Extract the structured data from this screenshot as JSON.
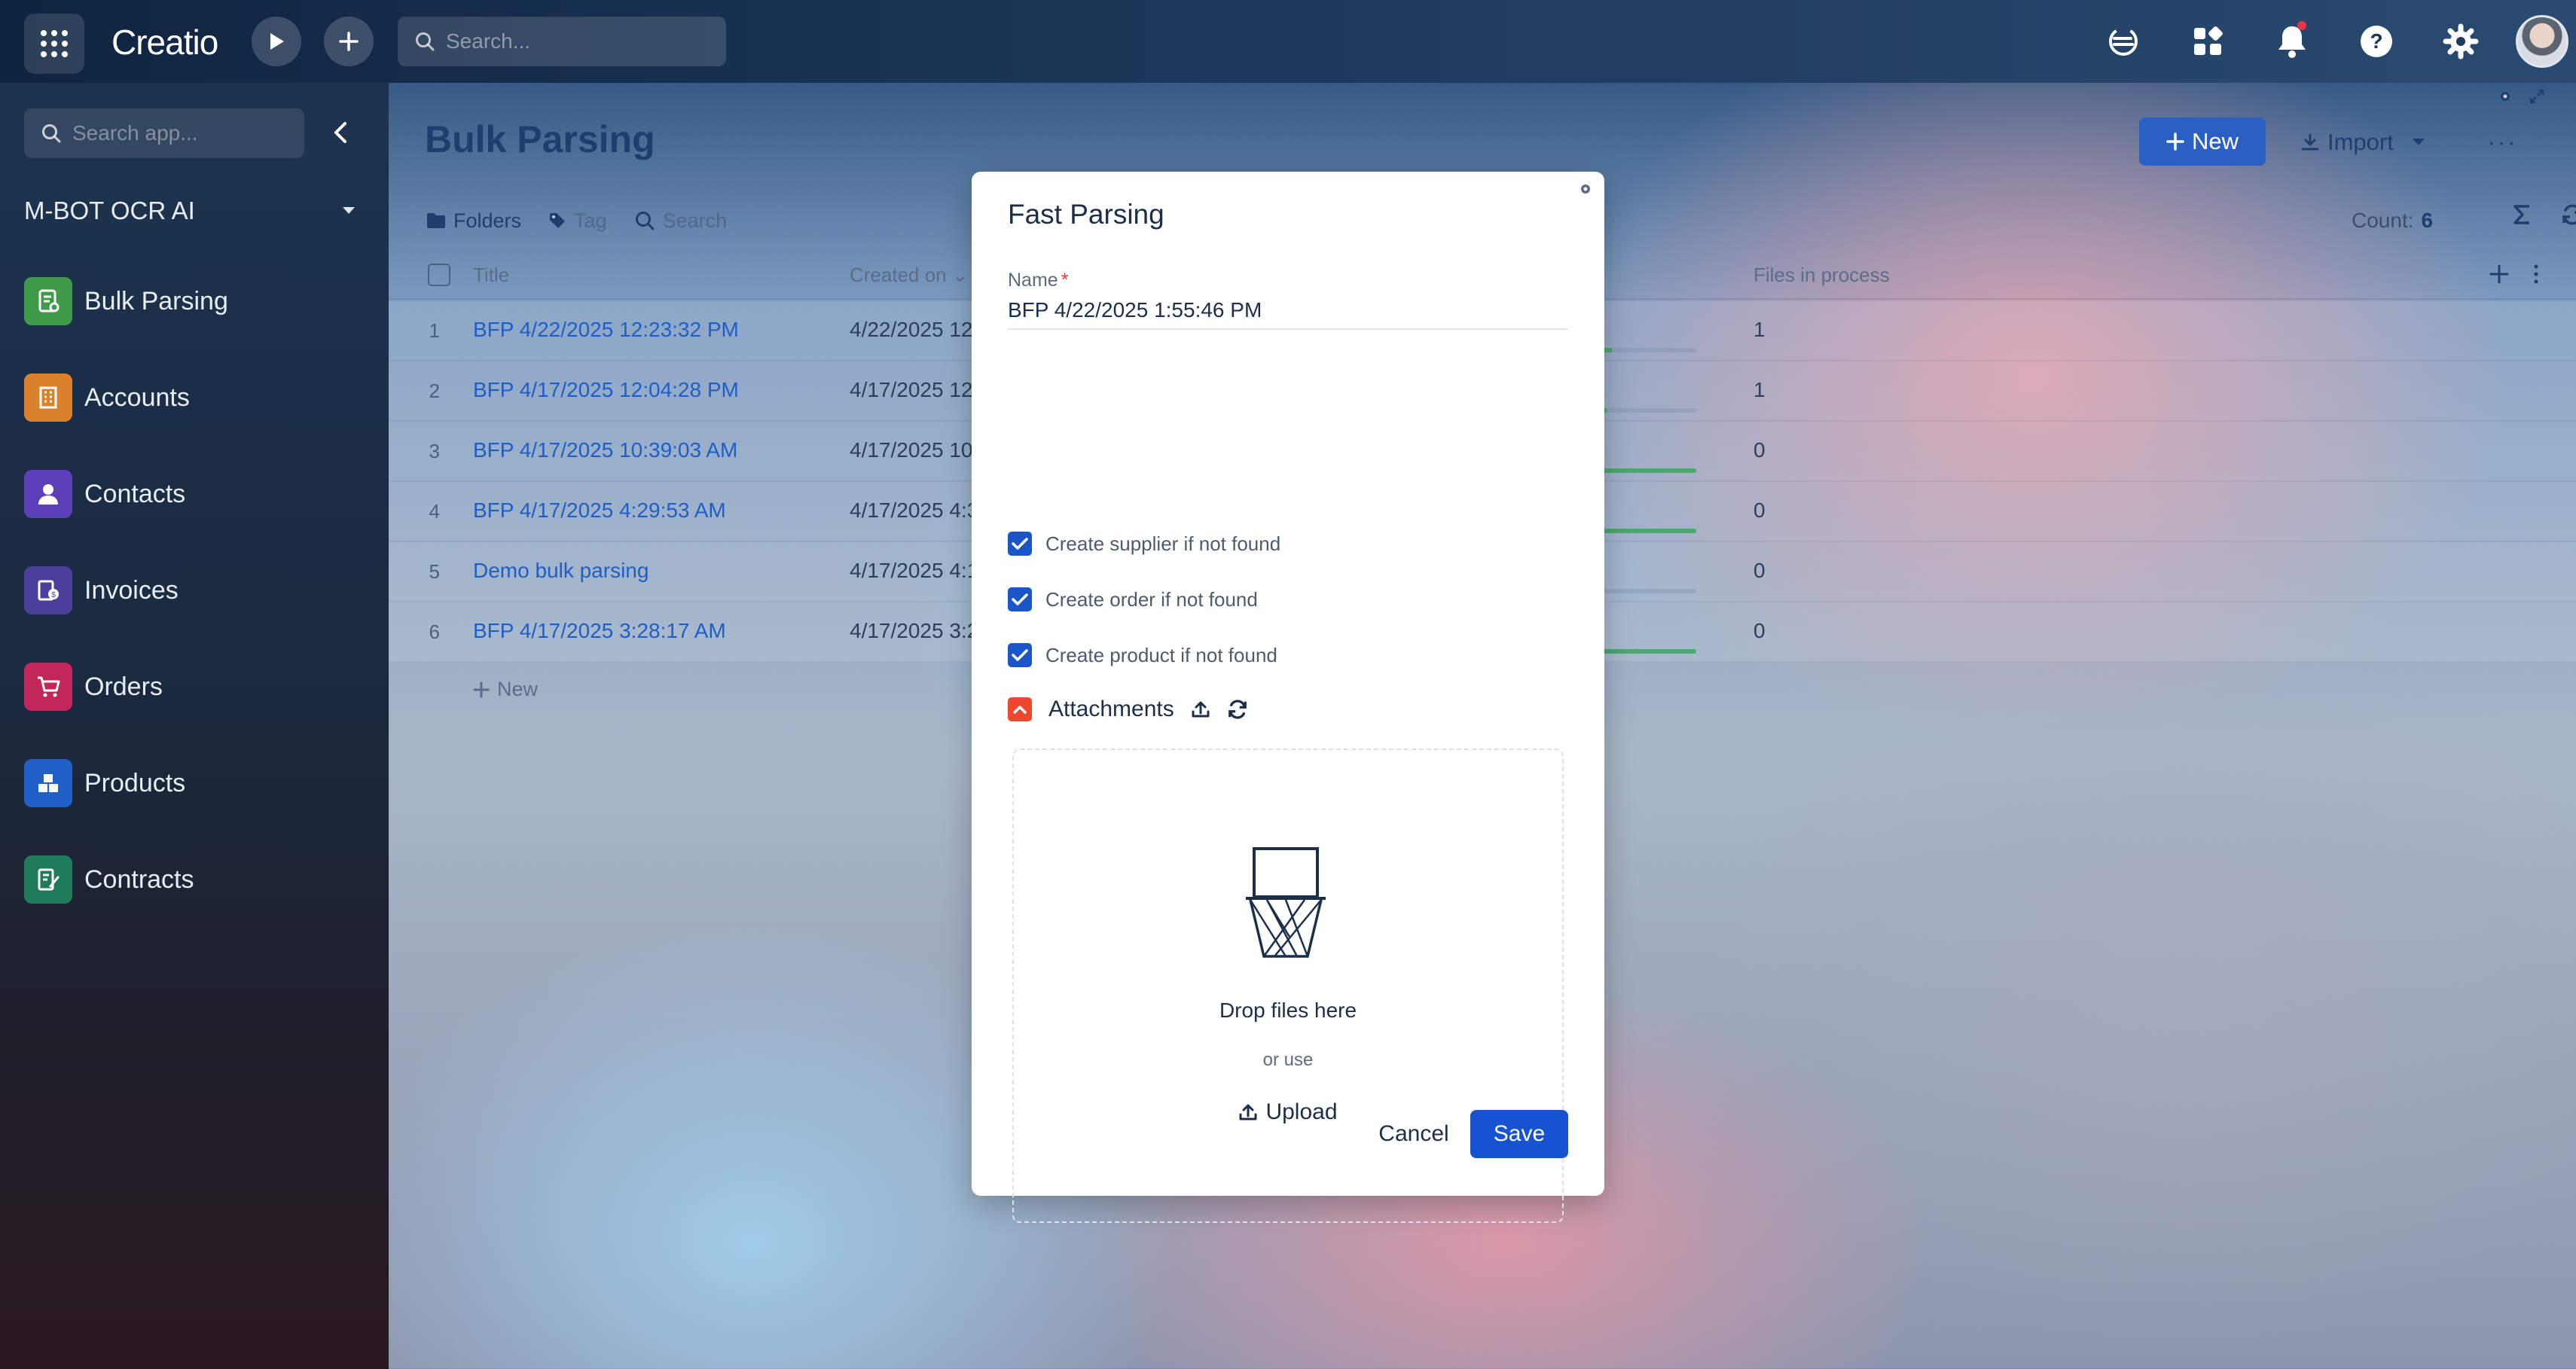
{
  "topbar": {
    "logo": "Creatio",
    "search_placeholder": "Search..."
  },
  "sidebar": {
    "search_placeholder": "Search app...",
    "workspace": "M-BOT OCR AI",
    "items": [
      {
        "label": "Bulk Parsing",
        "color": "#3f9b4a"
      },
      {
        "label": "Accounts",
        "color": "#d9822b"
      },
      {
        "label": "Contacts",
        "color": "#5b3fb8"
      },
      {
        "label": "Invoices",
        "color": "#4a3f9a"
      },
      {
        "label": "Orders",
        "color": "#c2265a"
      },
      {
        "label": "Products",
        "color": "#1f5fc7"
      },
      {
        "label": "Contracts",
        "color": "#1f7a5a"
      }
    ]
  },
  "main": {
    "title": "Bulk Parsing",
    "new_label": "New",
    "import_label": "Import",
    "more_label": "···",
    "toolbar": {
      "folders": "Folders",
      "tag": "Tag",
      "search": "Search"
    },
    "count_label": "Count:",
    "count_value": "6",
    "columns": {
      "title": "Title",
      "created_on": "Created on",
      "files_in_process": "Files in process"
    },
    "rows": [
      {
        "num": "1",
        "title": "BFP 4/22/2025 12:23:32 PM",
        "created": "4/22/2025 12",
        "files": "1",
        "progress": 0.2
      },
      {
        "num": "2",
        "title": "BFP 4/17/2025 12:04:28 PM",
        "created": "4/17/2025 12:",
        "files": "1",
        "progress": 0.15
      },
      {
        "num": "3",
        "title": "BFP 4/17/2025 10:39:03 AM",
        "created": "4/17/2025 10:",
        "files": "0",
        "progress": 1
      },
      {
        "num": "4",
        "title": "BFP 4/17/2025 4:29:53 AM",
        "created": "4/17/2025 4:3",
        "files": "0",
        "progress": 1
      },
      {
        "num": "5",
        "title": "Demo bulk parsing",
        "created": "4/17/2025 4:1",
        "files": "0",
        "progress": 0
      },
      {
        "num": "6",
        "title": "BFP 4/17/2025 3:28:17 AM",
        "created": "4/17/2025 3:2",
        "files": "0",
        "progress": 1
      }
    ],
    "add_row_label": "New"
  },
  "modal": {
    "title": "Fast Parsing",
    "name_label": "Name",
    "required_mark": "*",
    "name_value": "BFP 4/22/2025 1:55:46 PM",
    "checkboxes": [
      {
        "label": "Create supplier if not found",
        "checked": true
      },
      {
        "label": "Create order if not found",
        "checked": true
      },
      {
        "label": "Create product if not found",
        "checked": true
      }
    ],
    "attachments_label": "Attachments",
    "drop_text": "Drop files here",
    "or_text": "or use",
    "upload_label": "Upload",
    "cancel_label": "Cancel",
    "save_label": "Save"
  }
}
